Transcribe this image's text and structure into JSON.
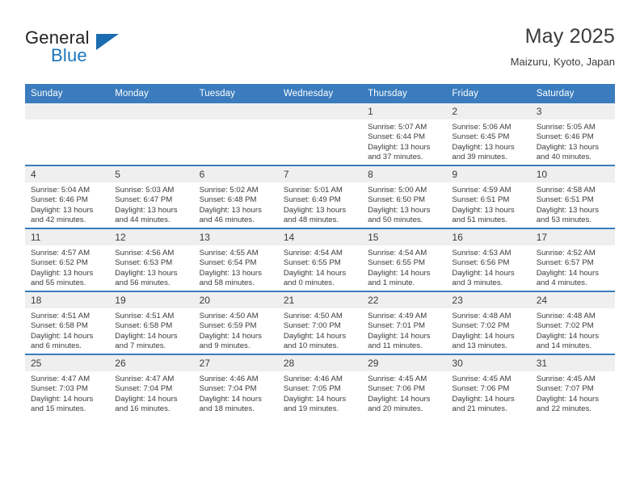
{
  "brand": {
    "word_one": "General",
    "word_two": "Blue",
    "accent_color": "#1b6cb0",
    "triangle_icon": "brand-triangle-icon"
  },
  "header": {
    "title": "May 2025",
    "subtitle": "Maizuru, Kyoto, Japan"
  },
  "calendar": {
    "header_bg": "#3a7cbd",
    "daynum_bg": "#efefef",
    "weekdays": [
      "Sunday",
      "Monday",
      "Tuesday",
      "Wednesday",
      "Thursday",
      "Friday",
      "Saturday"
    ],
    "weeks": [
      [
        {
          "day": "",
          "sunrise": "",
          "sunset": "",
          "daylight": "",
          "empty": true
        },
        {
          "day": "",
          "sunrise": "",
          "sunset": "",
          "daylight": "",
          "empty": true
        },
        {
          "day": "",
          "sunrise": "",
          "sunset": "",
          "daylight": "",
          "empty": true
        },
        {
          "day": "",
          "sunrise": "",
          "sunset": "",
          "daylight": "",
          "empty": true
        },
        {
          "day": "1",
          "sunrise": "Sunrise: 5:07 AM",
          "sunset": "Sunset: 6:44 PM",
          "daylight": "Daylight: 13 hours and 37 minutes."
        },
        {
          "day": "2",
          "sunrise": "Sunrise: 5:06 AM",
          "sunset": "Sunset: 6:45 PM",
          "daylight": "Daylight: 13 hours and 39 minutes."
        },
        {
          "day": "3",
          "sunrise": "Sunrise: 5:05 AM",
          "sunset": "Sunset: 6:46 PM",
          "daylight": "Daylight: 13 hours and 40 minutes."
        }
      ],
      [
        {
          "day": "4",
          "sunrise": "Sunrise: 5:04 AM",
          "sunset": "Sunset: 6:46 PM",
          "daylight": "Daylight: 13 hours and 42 minutes."
        },
        {
          "day": "5",
          "sunrise": "Sunrise: 5:03 AM",
          "sunset": "Sunset: 6:47 PM",
          "daylight": "Daylight: 13 hours and 44 minutes."
        },
        {
          "day": "6",
          "sunrise": "Sunrise: 5:02 AM",
          "sunset": "Sunset: 6:48 PM",
          "daylight": "Daylight: 13 hours and 46 minutes."
        },
        {
          "day": "7",
          "sunrise": "Sunrise: 5:01 AM",
          "sunset": "Sunset: 6:49 PM",
          "daylight": "Daylight: 13 hours and 48 minutes."
        },
        {
          "day": "8",
          "sunrise": "Sunrise: 5:00 AM",
          "sunset": "Sunset: 6:50 PM",
          "daylight": "Daylight: 13 hours and 50 minutes."
        },
        {
          "day": "9",
          "sunrise": "Sunrise: 4:59 AM",
          "sunset": "Sunset: 6:51 PM",
          "daylight": "Daylight: 13 hours and 51 minutes."
        },
        {
          "day": "10",
          "sunrise": "Sunrise: 4:58 AM",
          "sunset": "Sunset: 6:51 PM",
          "daylight": "Daylight: 13 hours and 53 minutes."
        }
      ],
      [
        {
          "day": "11",
          "sunrise": "Sunrise: 4:57 AM",
          "sunset": "Sunset: 6:52 PM",
          "daylight": "Daylight: 13 hours and 55 minutes."
        },
        {
          "day": "12",
          "sunrise": "Sunrise: 4:56 AM",
          "sunset": "Sunset: 6:53 PM",
          "daylight": "Daylight: 13 hours and 56 minutes."
        },
        {
          "day": "13",
          "sunrise": "Sunrise: 4:55 AM",
          "sunset": "Sunset: 6:54 PM",
          "daylight": "Daylight: 13 hours and 58 minutes."
        },
        {
          "day": "14",
          "sunrise": "Sunrise: 4:54 AM",
          "sunset": "Sunset: 6:55 PM",
          "daylight": "Daylight: 14 hours and 0 minutes."
        },
        {
          "day": "15",
          "sunrise": "Sunrise: 4:54 AM",
          "sunset": "Sunset: 6:55 PM",
          "daylight": "Daylight: 14 hours and 1 minute."
        },
        {
          "day": "16",
          "sunrise": "Sunrise: 4:53 AM",
          "sunset": "Sunset: 6:56 PM",
          "daylight": "Daylight: 14 hours and 3 minutes."
        },
        {
          "day": "17",
          "sunrise": "Sunrise: 4:52 AM",
          "sunset": "Sunset: 6:57 PM",
          "daylight": "Daylight: 14 hours and 4 minutes."
        }
      ],
      [
        {
          "day": "18",
          "sunrise": "Sunrise: 4:51 AM",
          "sunset": "Sunset: 6:58 PM",
          "daylight": "Daylight: 14 hours and 6 minutes."
        },
        {
          "day": "19",
          "sunrise": "Sunrise: 4:51 AM",
          "sunset": "Sunset: 6:58 PM",
          "daylight": "Daylight: 14 hours and 7 minutes."
        },
        {
          "day": "20",
          "sunrise": "Sunrise: 4:50 AM",
          "sunset": "Sunset: 6:59 PM",
          "daylight": "Daylight: 14 hours and 9 minutes."
        },
        {
          "day": "21",
          "sunrise": "Sunrise: 4:50 AM",
          "sunset": "Sunset: 7:00 PM",
          "daylight": "Daylight: 14 hours and 10 minutes."
        },
        {
          "day": "22",
          "sunrise": "Sunrise: 4:49 AM",
          "sunset": "Sunset: 7:01 PM",
          "daylight": "Daylight: 14 hours and 11 minutes."
        },
        {
          "day": "23",
          "sunrise": "Sunrise: 4:48 AM",
          "sunset": "Sunset: 7:02 PM",
          "daylight": "Daylight: 14 hours and 13 minutes."
        },
        {
          "day": "24",
          "sunrise": "Sunrise: 4:48 AM",
          "sunset": "Sunset: 7:02 PM",
          "daylight": "Daylight: 14 hours and 14 minutes."
        }
      ],
      [
        {
          "day": "25",
          "sunrise": "Sunrise: 4:47 AM",
          "sunset": "Sunset: 7:03 PM",
          "daylight": "Daylight: 14 hours and 15 minutes."
        },
        {
          "day": "26",
          "sunrise": "Sunrise: 4:47 AM",
          "sunset": "Sunset: 7:04 PM",
          "daylight": "Daylight: 14 hours and 16 minutes."
        },
        {
          "day": "27",
          "sunrise": "Sunrise: 4:46 AM",
          "sunset": "Sunset: 7:04 PM",
          "daylight": "Daylight: 14 hours and 18 minutes."
        },
        {
          "day": "28",
          "sunrise": "Sunrise: 4:46 AM",
          "sunset": "Sunset: 7:05 PM",
          "daylight": "Daylight: 14 hours and 19 minutes."
        },
        {
          "day": "29",
          "sunrise": "Sunrise: 4:45 AM",
          "sunset": "Sunset: 7:06 PM",
          "daylight": "Daylight: 14 hours and 20 minutes."
        },
        {
          "day": "30",
          "sunrise": "Sunrise: 4:45 AM",
          "sunset": "Sunset: 7:06 PM",
          "daylight": "Daylight: 14 hours and 21 minutes."
        },
        {
          "day": "31",
          "sunrise": "Sunrise: 4:45 AM",
          "sunset": "Sunset: 7:07 PM",
          "daylight": "Daylight: 14 hours and 22 minutes."
        }
      ]
    ]
  }
}
